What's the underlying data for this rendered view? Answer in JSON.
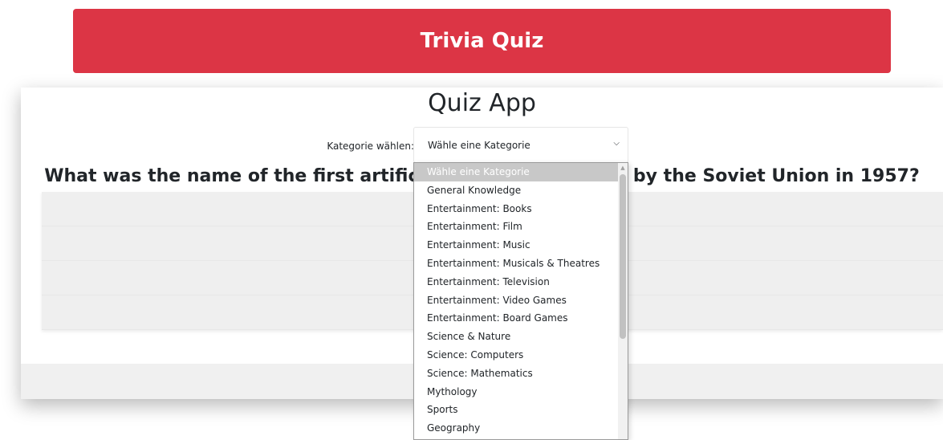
{
  "header": {
    "title": "Trivia Quiz",
    "color": "#dc3545"
  },
  "app": {
    "title": "Quiz App",
    "category_label": "Kategorie wählen:",
    "selected_category": "Wähle eine Kategorie",
    "question": "What was the name of the first artificial satellite launched by the Soviet Union in 1957?"
  },
  "dropdown": {
    "options": [
      "Wähle eine Kategorie",
      "General Knowledge",
      "Entertainment: Books",
      "Entertainment: Film",
      "Entertainment: Music",
      "Entertainment: Musicals & Theatres",
      "Entertainment: Television",
      "Entertainment: Video Games",
      "Entertainment: Board Games",
      "Science & Nature",
      "Science: Computers",
      "Science: Mathematics",
      "Mythology",
      "Sports",
      "Geography"
    ]
  },
  "icons": {
    "select_chevron": "chevron-down-icon",
    "scroll_up": "scroll-up-arrow-icon"
  }
}
